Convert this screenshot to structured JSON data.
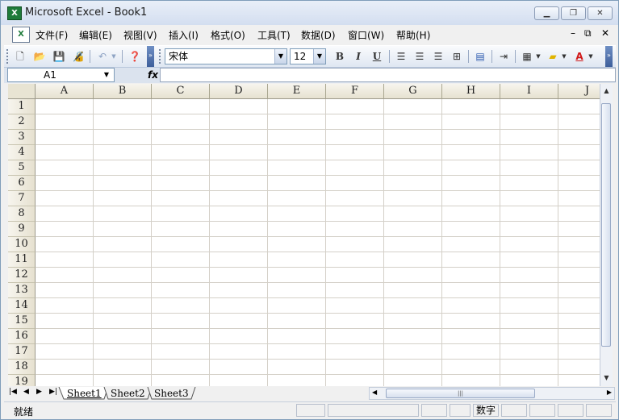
{
  "window": {
    "title": "Microsoft Excel - Book1",
    "app_icon": "excel-icon",
    "controls": [
      "minimize-icon",
      "restore-icon",
      "close-icon"
    ]
  },
  "menubar": {
    "items": [
      "文件(F)",
      "编辑(E)",
      "视图(V)",
      "插入(I)",
      "格式(O)",
      "工具(T)",
      "数据(D)",
      "窗口(W)",
      "帮助(H)"
    ],
    "mdi_controls": [
      "minimize-icon",
      "restore-icon",
      "close-icon"
    ]
  },
  "toolbar": {
    "font_name": "宋体",
    "font_size": "12",
    "bold": "B",
    "italic": "I",
    "underline": "U"
  },
  "formula_bar": {
    "name_box": "A1",
    "fx_label": "fx",
    "formula": ""
  },
  "grid": {
    "columns": [
      "A",
      "B",
      "C",
      "D",
      "E",
      "F",
      "G",
      "H",
      "I",
      "J"
    ],
    "rows": [
      "1",
      "2",
      "3",
      "4",
      "5",
      "6",
      "7",
      "8",
      "9",
      "10",
      "11",
      "12",
      "13",
      "14",
      "15",
      "16",
      "17",
      "18",
      "19"
    ]
  },
  "sheets": {
    "tabs": [
      "Sheet1",
      "Sheet2",
      "Sheet3"
    ],
    "active": "Sheet1"
  },
  "statusbar": {
    "status": "就绪",
    "mode": "数字"
  },
  "colors": {
    "title_bar": "#d3def0",
    "header_bg": "#e6e1d0",
    "grid_line": "#d4d0c8"
  }
}
